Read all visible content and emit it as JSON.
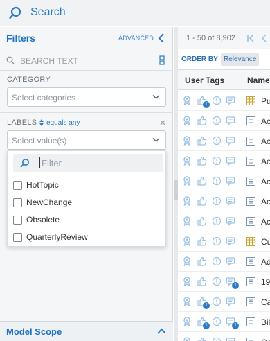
{
  "search": {
    "label": "Search"
  },
  "filters": {
    "title": "Filters",
    "advanced_label": "ADVANCED",
    "search_placeholder": "SEARCH TEXT",
    "category": {
      "label": "CATEGORY",
      "placeholder": "Select categories"
    },
    "labels": {
      "label": "LABELS",
      "operator": "equals any",
      "placeholder": "Select value(s)",
      "dropdown": {
        "filter_placeholder": "Filter",
        "options": [
          "HotTopic",
          "NewChange",
          "Obsolete",
          "QuarterlyReview"
        ]
      }
    },
    "model_scope": "Model Scope"
  },
  "results": {
    "count_text": "1 - 50 of 8,902",
    "order_by_label": "ORDER BY",
    "order_by_value": "Relevance",
    "columns": {
      "user_tags": "User Tags",
      "name": "Name"
    },
    "rows": [
      {
        "name": "Pu",
        "type": "table",
        "like_badge": "1",
        "comment_badge": ""
      },
      {
        "name": "Ac",
        "type": "document",
        "like_badge": "",
        "comment_badge": ""
      },
      {
        "name": "Ac",
        "type": "document",
        "like_badge": "",
        "comment_badge": ""
      },
      {
        "name": "Ac",
        "type": "document",
        "like_badge": "",
        "comment_badge": ""
      },
      {
        "name": "Ac",
        "type": "document",
        "like_badge": "",
        "comment_badge": ""
      },
      {
        "name": "Ac",
        "type": "document",
        "like_badge": "",
        "comment_badge": ""
      },
      {
        "name": "Ac",
        "type": "document",
        "like_badge": "",
        "comment_badge": ""
      },
      {
        "name": "Cu",
        "type": "table",
        "like_badge": "",
        "comment_badge": ""
      },
      {
        "name": "Ad",
        "type": "document",
        "like_badge": "",
        "comment_badge": ""
      },
      {
        "name": "19",
        "type": "document",
        "like_badge": "",
        "comment_badge": "1"
      },
      {
        "name": "Ca",
        "type": "document",
        "like_badge": "1",
        "comment_badge": ""
      },
      {
        "name": "Bil",
        "type": "document",
        "like_badge": "1",
        "comment_badge": "1"
      },
      {
        "name": "Ca",
        "type": "document",
        "like_badge": "",
        "comment_badge": ""
      }
    ]
  },
  "colors": {
    "accent": "#2a7bc5",
    "icon_light": "#9cc3e6"
  }
}
